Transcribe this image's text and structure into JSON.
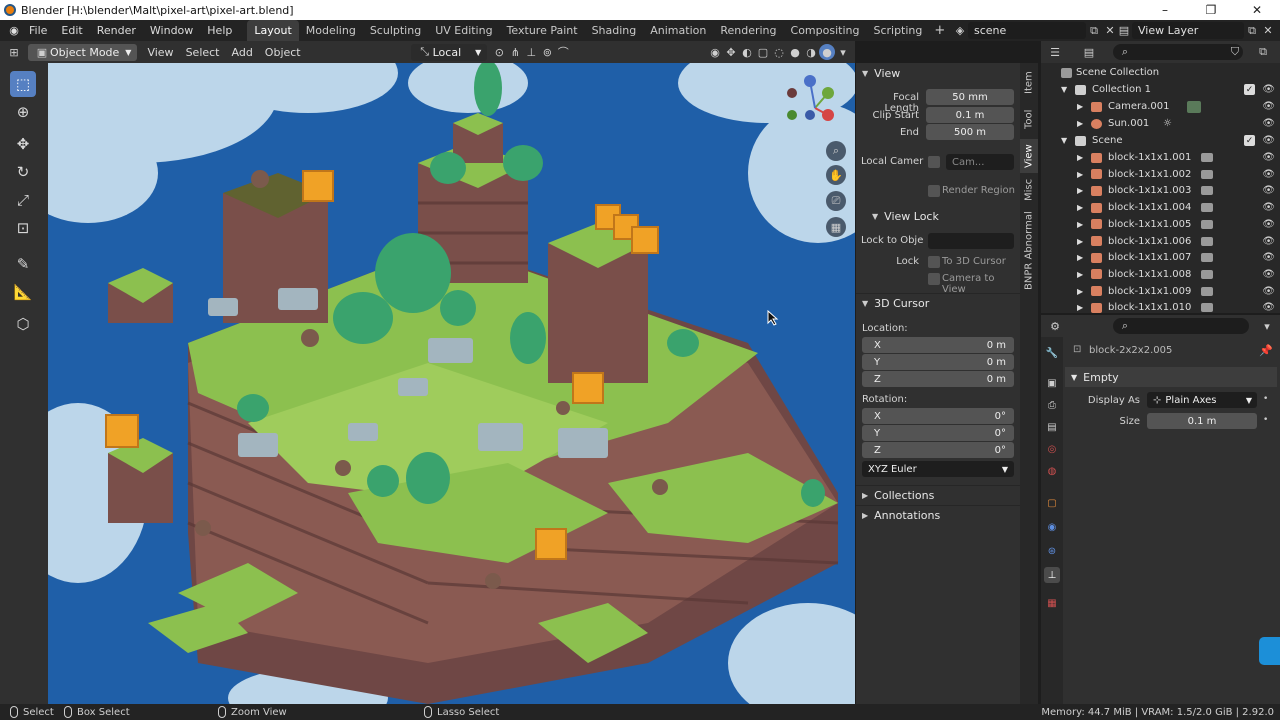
{
  "window": {
    "title": "Blender [H:\\blender\\Malt\\pixel-art\\pixel-art.blend]",
    "controls": [
      "–",
      "❐",
      "✕"
    ]
  },
  "topbar": {
    "menus": [
      "File",
      "Edit",
      "Render",
      "Window",
      "Help"
    ],
    "workspaces": [
      "Layout",
      "Modeling",
      "Sculpting",
      "UV Editing",
      "Texture Paint",
      "Shading",
      "Animation",
      "Rendering",
      "Compositing",
      "Scripting"
    ],
    "active_workspace": "Layout",
    "scene": "scene",
    "view_layer": "View Layer"
  },
  "viewport_header": {
    "mode": "Object Mode",
    "menus": [
      "View",
      "Select",
      "Add",
      "Object"
    ],
    "transform_orientation": "Local"
  },
  "npanel": {
    "view": {
      "title": "View",
      "focal_length_label": "Focal Length",
      "focal_length": "50 mm",
      "clip_start_label": "Clip Start",
      "clip_start": "0.1 m",
      "clip_end_label": "End",
      "clip_end": "500 m",
      "local_camera_label": "Local Camer",
      "local_camera_value": "Cam...",
      "render_region_label": "Render Region",
      "view_lock_title": "View Lock",
      "lock_to_object_label": "Lock to Obje",
      "lock_label": "Lock",
      "to_3d_cursor_label": "To 3D Cursor",
      "camera_to_view_label": "Camera to View"
    },
    "cursor": {
      "title": "3D Cursor",
      "location_label": "Location:",
      "loc_x_label": "X",
      "loc_x": "0 m",
      "loc_y_label": "Y",
      "loc_y": "0 m",
      "loc_z_label": "Z",
      "loc_z": "0 m",
      "rotation_label": "Rotation:",
      "rot_x_label": "X",
      "rot_x": "0°",
      "rot_y_label": "Y",
      "rot_y": "0°",
      "rot_z_label": "Z",
      "rot_z": "0°",
      "rotation_mode": "XYZ Euler"
    },
    "collections_title": "Collections",
    "annotations_title": "Annotations"
  },
  "sidebar_tabs": [
    "Item",
    "Tool",
    "View",
    "Misc",
    "BNPR Abnormal"
  ],
  "outliner": {
    "root": "Scene Collection",
    "collection1": "Collection 1",
    "camera": "Camera.001",
    "sun": "Sun.001",
    "scene_collection": "Scene",
    "blocks": [
      "block-1x1x1.001",
      "block-1x1x1.002",
      "block-1x1x1.003",
      "block-1x1x1.004",
      "block-1x1x1.005",
      "block-1x1x1.006",
      "block-1x1x1.007",
      "block-1x1x1.008",
      "block-1x1x1.009",
      "block-1x1x1.010"
    ]
  },
  "properties": {
    "object_name": "block-2x2x2.005",
    "section": "Empty",
    "display_as_label": "Display As",
    "display_as": "Plain Axes",
    "size_label": "Size",
    "size": "0.1 m"
  },
  "statusbar": {
    "select": "Select",
    "box_select": "Box Select",
    "zoom_view": "Zoom View",
    "lasso_select": "Lasso Select",
    "stats": "Memory: 44.7 MiB | VRAM: 1.5/2.0 GiB | 2.92.0"
  },
  "colors": {
    "sky": "#1f5fa8",
    "grass": "#8cc04f",
    "dirt": "#7a4f4a",
    "tree": "#3aa36d",
    "accent": "#5680c2"
  }
}
